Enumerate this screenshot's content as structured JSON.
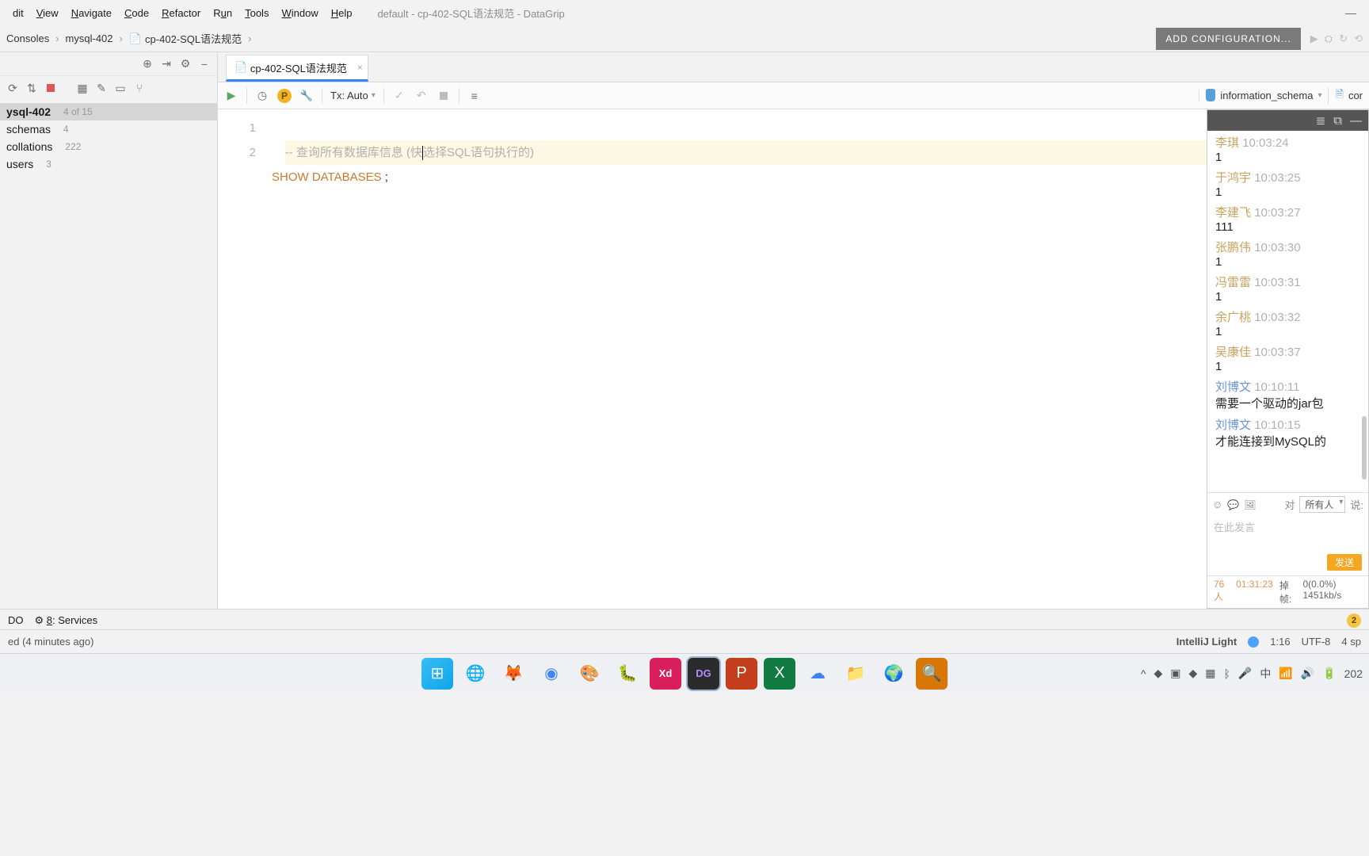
{
  "window": {
    "title": "default - cp-402-SQL语法规范 - DataGrip",
    "min": "—"
  },
  "menu": {
    "items": [
      "dit",
      "View",
      "Navigate",
      "Code",
      "Refactor",
      "Run",
      "Tools",
      "Window",
      "Help"
    ],
    "underlines": [
      "d",
      "V",
      "N",
      "C",
      "R",
      "u",
      "T",
      "W",
      "H"
    ]
  },
  "breadcrumb": {
    "items": [
      "Consoles",
      "mysql-402",
      "cp-402-SQL语法规范"
    ]
  },
  "add_configuration": "ADD CONFIGURATION...",
  "sidebar": {
    "root": {
      "name": "ysql-402",
      "meta": "4 of 15"
    },
    "nodes": [
      {
        "label": "schemas",
        "count": "4"
      },
      {
        "label": "collations",
        "count": "222"
      },
      {
        "label": "users",
        "count": "3"
      }
    ]
  },
  "tab": {
    "label": "cp-402-SQL语法规范"
  },
  "editor_toolbar": {
    "tx": "Tx: Auto",
    "schema": "information_schema",
    "console": "cor"
  },
  "code": {
    "gutter": [
      "1",
      "2"
    ],
    "line1_prefix": "-- 查询所有数据库信息 (快",
    "line1_suffix": "选择SQL语句执行的)",
    "line2_kw": "SHOW DATABASES",
    "line2_tail": " ;"
  },
  "chat": {
    "messages": [
      {
        "name": "李琪",
        "cls": "warm",
        "time": "10:03:24",
        "text": "1"
      },
      {
        "name": "于鸿宇",
        "cls": "warm",
        "time": "10:03:25",
        "text": "1"
      },
      {
        "name": "李建飞",
        "cls": "warm",
        "time": "10:03:27",
        "text": "111"
      },
      {
        "name": "张鹏伟",
        "cls": "warm",
        "time": "10:03:30",
        "text": "1"
      },
      {
        "name": "冯雷雷",
        "cls": "warm",
        "time": "10:03:31",
        "text": "1"
      },
      {
        "name": "余广桃",
        "cls": "warm",
        "time": "10:03:32",
        "text": "1"
      },
      {
        "name": "吴康佳",
        "cls": "warm",
        "time": "10:03:37",
        "text": "1"
      },
      {
        "name": "刘博文",
        "cls": "blue",
        "time": "10:10:11",
        "text": "需要一个驱动的jar包"
      },
      {
        "name": "刘博文",
        "cls": "blue",
        "time": "10:10:15",
        "text": "才能连接到MySQL的"
      }
    ],
    "to_label": "对",
    "to_value": "所有人",
    "say_label": "说:",
    "placeholder": "在此发言",
    "send": "发送",
    "people": "76人",
    "elapsed": "01:31:23",
    "drop_label": "掉帧:",
    "drop_val": "0(0.0%) 1451kb/s"
  },
  "bottom": {
    "left1": "DO",
    "services_icon": "⚙",
    "services_key": "8",
    "services": "Services",
    "badge": "2"
  },
  "status": {
    "left": "ed (4 minutes ago)",
    "theme": "IntelliJ Light",
    "pos": "1:16",
    "enc": "UTF-8",
    "indent": "4 sp"
  },
  "tray": {
    "time": "202"
  }
}
